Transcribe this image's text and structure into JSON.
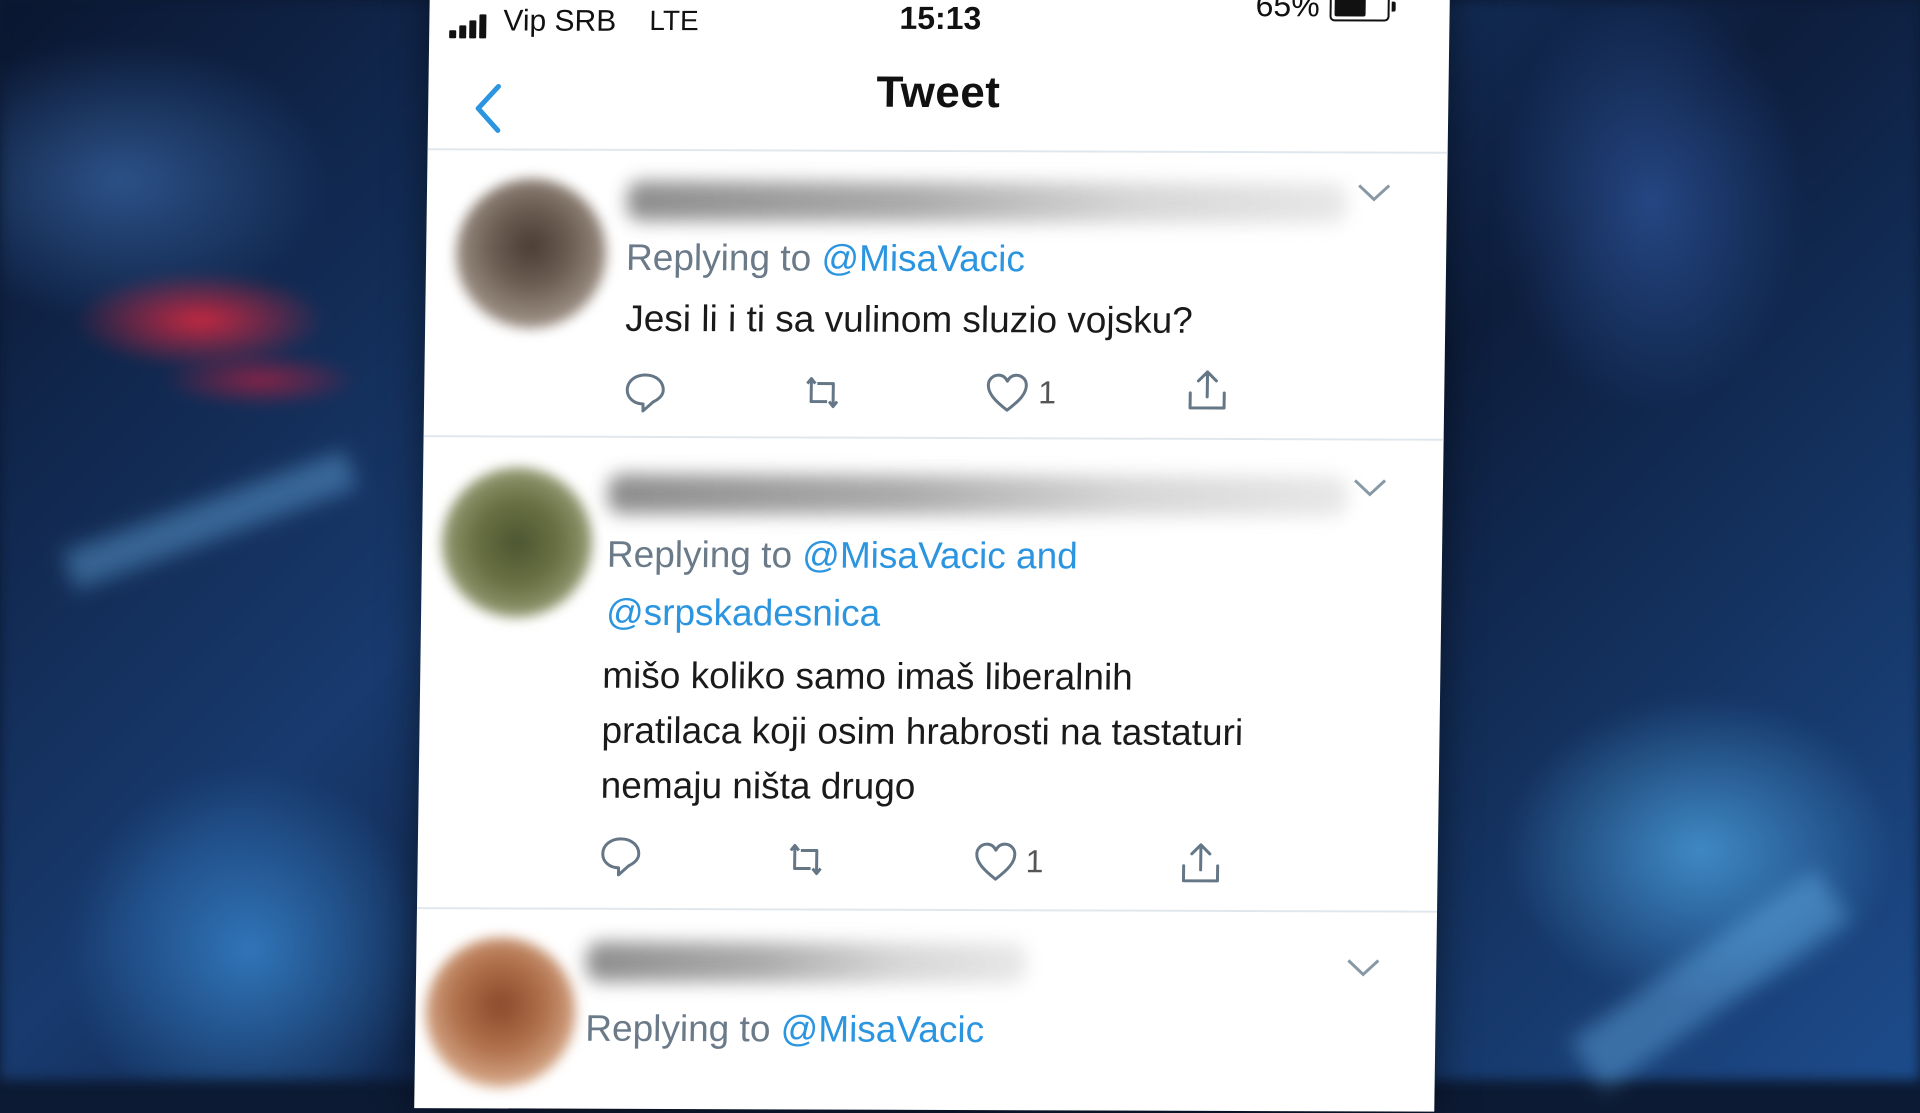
{
  "status_bar": {
    "carrier": "Vip SRB",
    "network": "LTE",
    "time": "15:13",
    "battery": "65%",
    "battery_level": 0.65
  },
  "nav": {
    "title": "Tweet",
    "back_icon": "chevron-left-icon"
  },
  "colors": {
    "accent": "#2b95e0",
    "secondary_text": "#6b7a88",
    "divider": "#e1e8ed"
  },
  "tweets": [
    {
      "replying_prefix": "Replying to",
      "mentions": "@MisaVacic",
      "mentions_line2": "",
      "body_lines": [
        "Jesi li i ti sa vulinom sluzio vojsku?"
      ],
      "likes": "1"
    },
    {
      "replying_prefix": "Replying to",
      "mentions": "@MisaVacic and",
      "mentions_line2": "@srpskadesnica",
      "body_lines": [
        "mišo koliko samo imaš liberalnih",
        "pratilaca koji osim hrabrosti na tastaturi",
        "nemaju ništa drugo"
      ],
      "likes": "1"
    },
    {
      "replying_prefix": "Replying to",
      "mentions": "@MisaVacic",
      "mentions_line2": "",
      "body_lines": [],
      "likes": ""
    }
  ]
}
